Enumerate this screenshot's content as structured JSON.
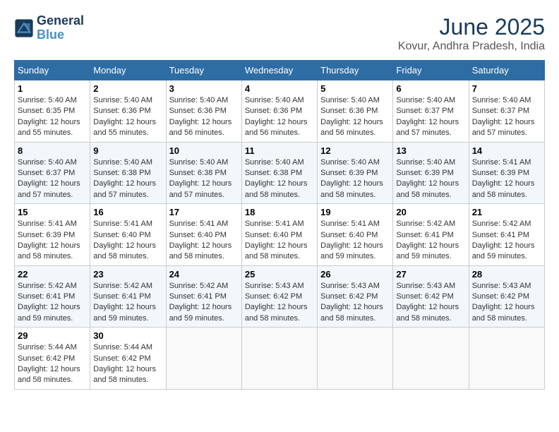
{
  "logo": {
    "line1": "General",
    "line2": "Blue"
  },
  "title": "June 2025",
  "location": "Kovur, Andhra Pradesh, India",
  "days_of_week": [
    "Sunday",
    "Monday",
    "Tuesday",
    "Wednesday",
    "Thursday",
    "Friday",
    "Saturday"
  ],
  "weeks": [
    [
      {
        "day": "1",
        "sunrise": "Sunrise: 5:40 AM",
        "sunset": "Sunset: 6:35 PM",
        "daylight": "Daylight: 12 hours and 55 minutes."
      },
      {
        "day": "2",
        "sunrise": "Sunrise: 5:40 AM",
        "sunset": "Sunset: 6:36 PM",
        "daylight": "Daylight: 12 hours and 55 minutes."
      },
      {
        "day": "3",
        "sunrise": "Sunrise: 5:40 AM",
        "sunset": "Sunset: 6:36 PM",
        "daylight": "Daylight: 12 hours and 56 minutes."
      },
      {
        "day": "4",
        "sunrise": "Sunrise: 5:40 AM",
        "sunset": "Sunset: 6:36 PM",
        "daylight": "Daylight: 12 hours and 56 minutes."
      },
      {
        "day": "5",
        "sunrise": "Sunrise: 5:40 AM",
        "sunset": "Sunset: 6:36 PM",
        "daylight": "Daylight: 12 hours and 56 minutes."
      },
      {
        "day": "6",
        "sunrise": "Sunrise: 5:40 AM",
        "sunset": "Sunset: 6:37 PM",
        "daylight": "Daylight: 12 hours and 57 minutes."
      },
      {
        "day": "7",
        "sunrise": "Sunrise: 5:40 AM",
        "sunset": "Sunset: 6:37 PM",
        "daylight": "Daylight: 12 hours and 57 minutes."
      }
    ],
    [
      {
        "day": "8",
        "sunrise": "Sunrise: 5:40 AM",
        "sunset": "Sunset: 6:37 PM",
        "daylight": "Daylight: 12 hours and 57 minutes."
      },
      {
        "day": "9",
        "sunrise": "Sunrise: 5:40 AM",
        "sunset": "Sunset: 6:38 PM",
        "daylight": "Daylight: 12 hours and 57 minutes."
      },
      {
        "day": "10",
        "sunrise": "Sunrise: 5:40 AM",
        "sunset": "Sunset: 6:38 PM",
        "daylight": "Daylight: 12 hours and 57 minutes."
      },
      {
        "day": "11",
        "sunrise": "Sunrise: 5:40 AM",
        "sunset": "Sunset: 6:38 PM",
        "daylight": "Daylight: 12 hours and 58 minutes."
      },
      {
        "day": "12",
        "sunrise": "Sunrise: 5:40 AM",
        "sunset": "Sunset: 6:39 PM",
        "daylight": "Daylight: 12 hours and 58 minutes."
      },
      {
        "day": "13",
        "sunrise": "Sunrise: 5:40 AM",
        "sunset": "Sunset: 6:39 PM",
        "daylight": "Daylight: 12 hours and 58 minutes."
      },
      {
        "day": "14",
        "sunrise": "Sunrise: 5:41 AM",
        "sunset": "Sunset: 6:39 PM",
        "daylight": "Daylight: 12 hours and 58 minutes."
      }
    ],
    [
      {
        "day": "15",
        "sunrise": "Sunrise: 5:41 AM",
        "sunset": "Sunset: 6:39 PM",
        "daylight": "Daylight: 12 hours and 58 minutes."
      },
      {
        "day": "16",
        "sunrise": "Sunrise: 5:41 AM",
        "sunset": "Sunset: 6:40 PM",
        "daylight": "Daylight: 12 hours and 58 minutes."
      },
      {
        "day": "17",
        "sunrise": "Sunrise: 5:41 AM",
        "sunset": "Sunset: 6:40 PM",
        "daylight": "Daylight: 12 hours and 58 minutes."
      },
      {
        "day": "18",
        "sunrise": "Sunrise: 5:41 AM",
        "sunset": "Sunset: 6:40 PM",
        "daylight": "Daylight: 12 hours and 58 minutes."
      },
      {
        "day": "19",
        "sunrise": "Sunrise: 5:41 AM",
        "sunset": "Sunset: 6:40 PM",
        "daylight": "Daylight: 12 hours and 59 minutes."
      },
      {
        "day": "20",
        "sunrise": "Sunrise: 5:42 AM",
        "sunset": "Sunset: 6:41 PM",
        "daylight": "Daylight: 12 hours and 59 minutes."
      },
      {
        "day": "21",
        "sunrise": "Sunrise: 5:42 AM",
        "sunset": "Sunset: 6:41 PM",
        "daylight": "Daylight: 12 hours and 59 minutes."
      }
    ],
    [
      {
        "day": "22",
        "sunrise": "Sunrise: 5:42 AM",
        "sunset": "Sunset: 6:41 PM",
        "daylight": "Daylight: 12 hours and 59 minutes."
      },
      {
        "day": "23",
        "sunrise": "Sunrise: 5:42 AM",
        "sunset": "Sunset: 6:41 PM",
        "daylight": "Daylight: 12 hours and 59 minutes."
      },
      {
        "day": "24",
        "sunrise": "Sunrise: 5:42 AM",
        "sunset": "Sunset: 6:41 PM",
        "daylight": "Daylight: 12 hours and 59 minutes."
      },
      {
        "day": "25",
        "sunrise": "Sunrise: 5:43 AM",
        "sunset": "Sunset: 6:42 PM",
        "daylight": "Daylight: 12 hours and 58 minutes."
      },
      {
        "day": "26",
        "sunrise": "Sunrise: 5:43 AM",
        "sunset": "Sunset: 6:42 PM",
        "daylight": "Daylight: 12 hours and 58 minutes."
      },
      {
        "day": "27",
        "sunrise": "Sunrise: 5:43 AM",
        "sunset": "Sunset: 6:42 PM",
        "daylight": "Daylight: 12 hours and 58 minutes."
      },
      {
        "day": "28",
        "sunrise": "Sunrise: 5:43 AM",
        "sunset": "Sunset: 6:42 PM",
        "daylight": "Daylight: 12 hours and 58 minutes."
      }
    ],
    [
      {
        "day": "29",
        "sunrise": "Sunrise: 5:44 AM",
        "sunset": "Sunset: 6:42 PM",
        "daylight": "Daylight: 12 hours and 58 minutes."
      },
      {
        "day": "30",
        "sunrise": "Sunrise: 5:44 AM",
        "sunset": "Sunset: 6:42 PM",
        "daylight": "Daylight: 12 hours and 58 minutes."
      },
      null,
      null,
      null,
      null,
      null
    ]
  ]
}
